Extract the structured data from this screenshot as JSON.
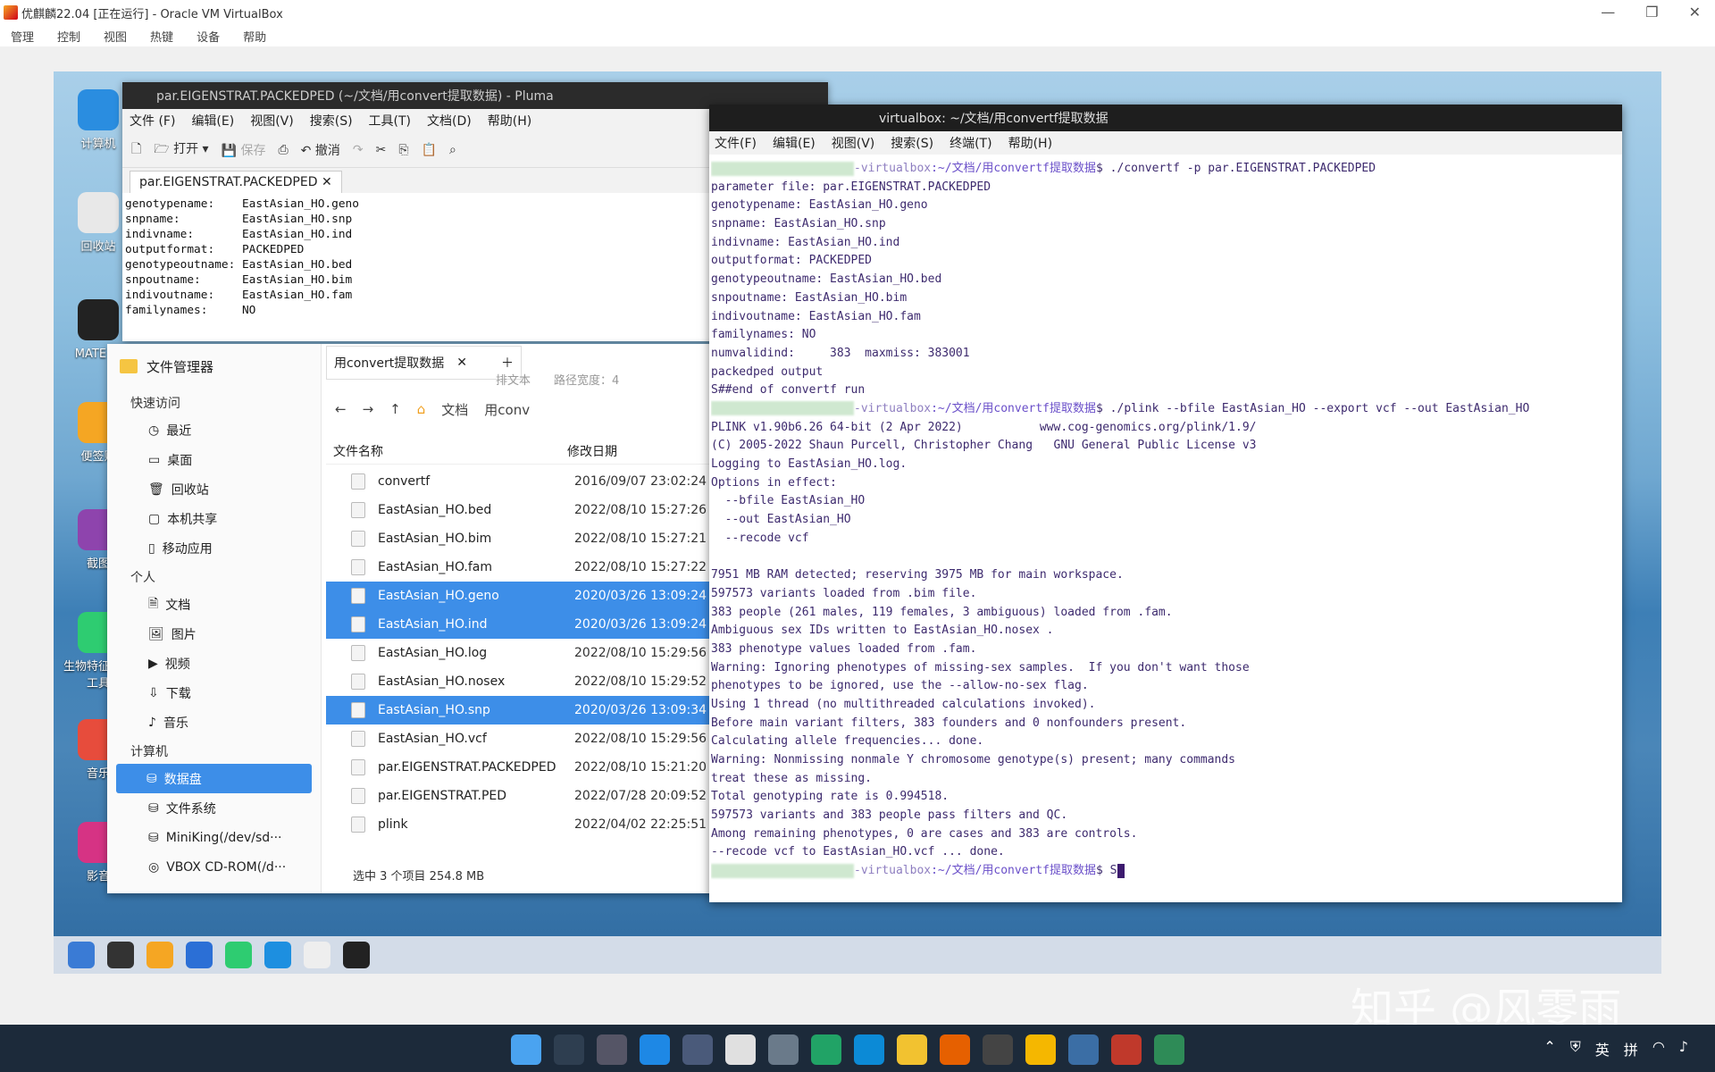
{
  "host": {
    "title": "优麒麟22.04 [正在运行] - Oracle VM VirtualBox",
    "menu": [
      "管理",
      "控制",
      "视图",
      "热键",
      "设备",
      "帮助"
    ]
  },
  "desktop": {
    "icons": [
      "计算机",
      "回收站",
      "MATE 终",
      "便签贴",
      "截图",
      "生物特征管理工具",
      "音乐",
      "影音"
    ]
  },
  "pluma": {
    "title": "par.EIGENSTRAT.PACKEDPED (~/文档/用convert提取数据) - Pluma",
    "menu": [
      "文件 (F)",
      "编辑(E)",
      "视图(V)",
      "搜索(S)",
      "工具(T)",
      "文档(D)",
      "帮助(H)"
    ],
    "toolbar": {
      "open": "打开",
      "save": "保存",
      "undo": "撤消"
    },
    "tab": "par.EIGENSTRAT.PACKEDPED",
    "content": "genotypename:    EastAsian_HO.geno\nsnpname:         EastAsian_HO.snp\nindivname:       EastAsian_HO.ind\noutputformat:    PACKEDPED\ngenotypeoutname: EastAsian_HO.bed\nsnpoutname:      EastAsian_HO.bim\nindivoutname:    EastAsian_HO.fam\nfamilynames:     NO"
  },
  "filemanager": {
    "header": "文件管理器",
    "sections": {
      "quick": "快速访问",
      "quick_items": [
        "最近",
        "桌面",
        "回收站",
        "本机共享",
        "移动应用"
      ],
      "personal": "个人",
      "personal_items": [
        "文档",
        "图片",
        "视频",
        "下载",
        "音乐"
      ],
      "computer": "计算机",
      "computer_items": [
        "数据盘",
        "文件系统",
        "MiniKing(/dev/sd···",
        "VBOX CD-ROM(/d···"
      ]
    },
    "tab": "用convert提取数据",
    "sort_label": "排文本",
    "path_label": "路径宽度：4",
    "path": {
      "seg1": "文档",
      "seg2": "用conv"
    },
    "columns": {
      "name": "文件名称",
      "date": "修改日期"
    },
    "files": [
      {
        "name": "convertf",
        "date": "2016/09/07 23:02:24",
        "sel": false
      },
      {
        "name": "EastAsian_HO.bed",
        "date": "2022/08/10 15:27:26",
        "sel": false
      },
      {
        "name": "EastAsian_HO.bim",
        "date": "2022/08/10 15:27:21",
        "sel": false
      },
      {
        "name": "EastAsian_HO.fam",
        "date": "2022/08/10 15:27:22",
        "sel": false
      },
      {
        "name": "EastAsian_HO.geno",
        "date": "2020/03/26 13:09:24",
        "sel": true
      },
      {
        "name": "EastAsian_HO.ind",
        "date": "2020/03/26 13:09:24",
        "sel": true
      },
      {
        "name": "EastAsian_HO.log",
        "date": "2022/08/10 15:29:56",
        "sel": false
      },
      {
        "name": "EastAsian_HO.nosex",
        "date": "2022/08/10 15:29:52",
        "sel": false
      },
      {
        "name": "EastAsian_HO.snp",
        "date": "2020/03/26 13:09:34",
        "sel": true
      },
      {
        "name": "EastAsian_HO.vcf",
        "date": "2022/08/10 15:29:56",
        "sel": false
      },
      {
        "name": "par.EIGENSTRAT.PACKEDPED",
        "date": "2022/08/10 15:21:20",
        "sel": false
      },
      {
        "name": "par.EIGENSTRAT.PED",
        "date": "2022/07/28 20:09:52",
        "sel": false
      },
      {
        "name": "plink",
        "date": "2022/04/02 22:25:51",
        "sel": false
      }
    ],
    "status": "选中 3 个项目    254.8 MB"
  },
  "terminal": {
    "title": "virtualbox: ~/文档/用convertf提取数据",
    "menu": [
      "文件(F)",
      "编辑(E)",
      "视图(V)",
      "搜索(S)",
      "终端(T)",
      "帮助(H)"
    ],
    "prompt_host": "-virtualbox",
    "prompt_path": ":~/文档/用convertf提取数据",
    "cmd1": "$ ./convertf -p par.EIGENSTRAT.PACKEDPED",
    "out1": [
      "parameter file: par.EIGENSTRAT.PACKEDPED",
      "genotypename: EastAsian_HO.geno",
      "snpname: EastAsian_HO.snp",
      "indivname: EastAsian_HO.ind",
      "outputformat: PACKEDPED",
      "genotypeoutname: EastAsian_HO.bed",
      "snpoutname: EastAsian_HO.bim",
      "indivoutname: EastAsian_HO.fam",
      "familynames: NO",
      "numvalidind:     383  maxmiss: 383001",
      "packedped output",
      "S##end of convertf run"
    ],
    "cmd2": "$ ./plink --bfile EastAsian_HO --export vcf --out EastAsian_HO",
    "out2": [
      "PLINK v1.90b6.26 64-bit (2 Apr 2022)           www.cog-genomics.org/plink/1.9/",
      "(C) 2005-2022 Shaun Purcell, Christopher Chang   GNU General Public License v3",
      "Logging to EastAsian_HO.log.",
      "Options in effect:",
      "  --bfile EastAsian_HO",
      "  --out EastAsian_HO",
      "  --recode vcf",
      "",
      "7951 MB RAM detected; reserving 3975 MB for main workspace.",
      "597573 variants loaded from .bim file.",
      "383 people (261 males, 119 females, 3 ambiguous) loaded from .fam.",
      "Ambiguous sex IDs written to EastAsian_HO.nosex .",
      "383 phenotype values loaded from .fam.",
      "Warning: Ignoring phenotypes of missing-sex samples.  If you don't want those",
      "phenotypes to be ignored, use the --allow-no-sex flag.",
      "Using 1 thread (no multithreaded calculations invoked).",
      "Before main variant filters, 383 founders and 0 nonfounders present.",
      "Calculating allele frequencies... done.",
      "Warning: Nonmissing nonmale Y chromosome genotype(s) present; many commands",
      "treat these as missing.",
      "Total genotyping rate is 0.994518.",
      "597573 variants and 383 people pass filters and QC.",
      "Among remaining phenotypes, 0 are cases and 383 are controls.",
      "--recode vcf to EastAsian_HO.vcf ... done."
    ],
    "cmd3": "$ S"
  },
  "watermark": "知乎 @风零雨",
  "host_tray": {
    "lang": "英",
    "ime": "拼"
  }
}
